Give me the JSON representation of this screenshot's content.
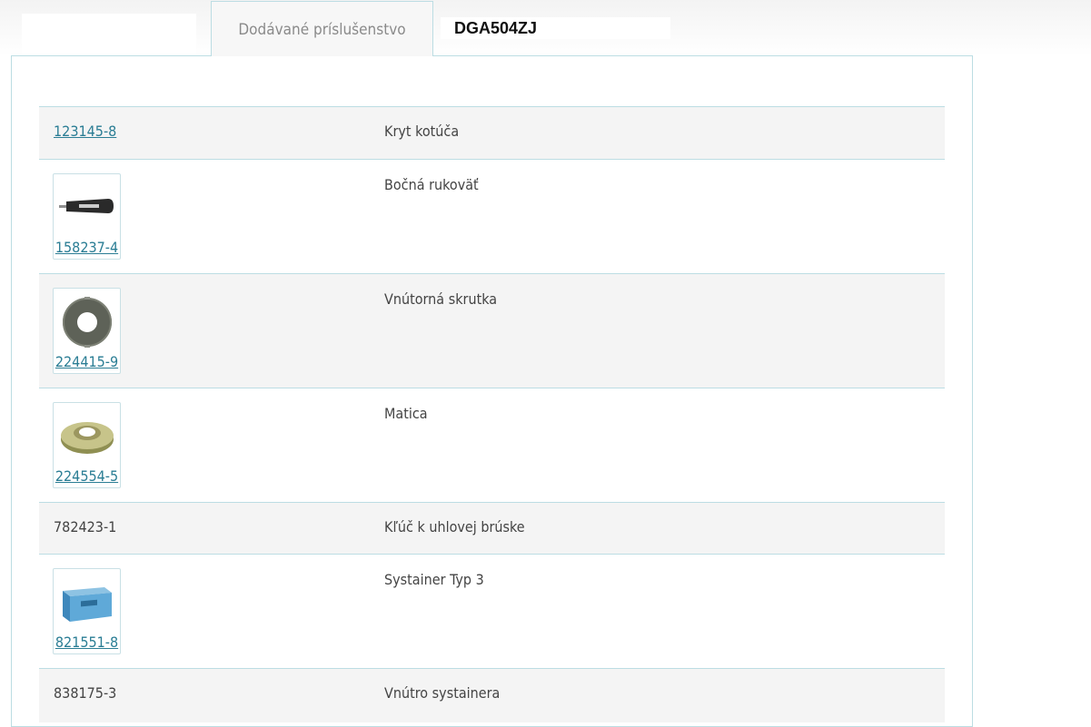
{
  "tabs": {
    "active_label": "Dodávané príslušenstvo",
    "model": "DGA504ZJ"
  },
  "rows": [
    {
      "code": "123145-8",
      "desc": "Kryt kotúča"
    },
    {
      "code": "158237-4",
      "desc": "Bočná rukoväť",
      "image": "side-handle"
    },
    {
      "code": "224415-9",
      "desc": "Vnútorná skrutka",
      "image": "inner-flange"
    },
    {
      "code": "224554-5",
      "desc": "Matica",
      "image": "lock-nut"
    },
    {
      "code": "782423-1",
      "desc": "Kľúč k uhlovej brúske"
    },
    {
      "code": "821551-8",
      "desc": "Systainer Typ 3",
      "image": "systainer-case"
    },
    {
      "code": "838175-3",
      "desc": "Vnútro systainera"
    }
  ],
  "colors": {
    "link": "#2a7d94",
    "border": "#bcdde3",
    "row_alt": "#f4f4f4"
  }
}
